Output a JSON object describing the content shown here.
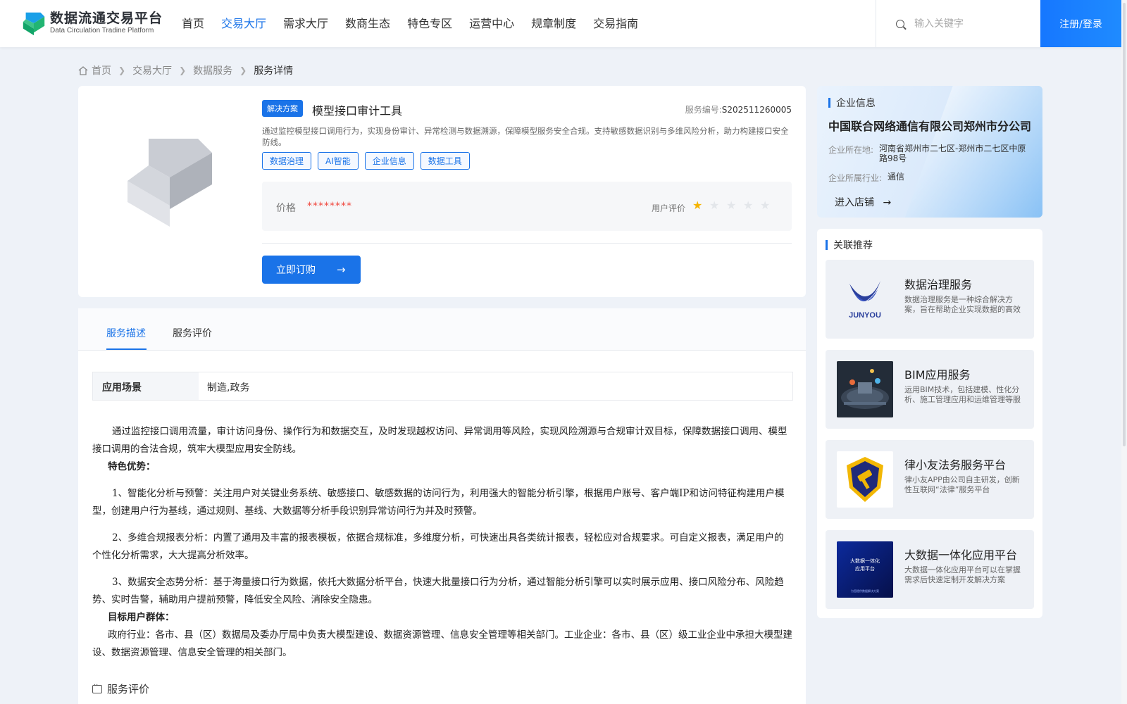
{
  "header": {
    "logo_cn": "数据流通交易平台",
    "logo_en": "Data Circulation Tradine Platform",
    "nav": [
      "首页",
      "交易大厅",
      "需求大厅",
      "数商生态",
      "特色专区",
      "运营中心",
      "规章制度",
      "交易指南"
    ],
    "nav_active_index": 1,
    "search_placeholder": "输入关键字",
    "login_label": "注册/登录"
  },
  "breadcrumb": {
    "items": [
      "首页",
      "交易大厅",
      "数据服务",
      "服务详情"
    ]
  },
  "product": {
    "badge": "解决方案",
    "title": "模型接口审计工具",
    "code_label": "服务编号:",
    "code": "S202511260005",
    "description": "通过监控模型接口调用行为，实现身份审计、异常检测与数据溯源，保障模型服务安全合规。支持敏感数据识别与多维风险分析，助力构建接口安全防线。",
    "tags": [
      "数据治理",
      "AI智能",
      "企业信息",
      "数据工具"
    ],
    "price_label": "价格",
    "price_value": "********",
    "rating_label": "用户评价",
    "rating": 1,
    "rating_max": 5,
    "buy_label": "立即订购"
  },
  "tabs": [
    "服务描述",
    "服务评价"
  ],
  "scene": {
    "key": "应用场景",
    "value": "制造,政务"
  },
  "content": {
    "intro": "通过监控接口调用流量，审计访问身份、操作行为和数据交互，及时发现越权访问、异常调用等风险，实现风险溯源与合规审计双目标，保障数据接口调用、模型接口调用的合法合规，筑牢大模型应用安全防线。",
    "advantages_head": "特色优势：",
    "adv1": "1、智能化分析与预警：关注用户对关键业务系统、敏感接口、敏感数据的访问行为，利用强大的智能分析引擎，根据用户账号、客户端IP和访问特征构建用户模型，创建用户行为基线，通过规则、基线、大数据等分析手段识别异常访问行为并及时预警。",
    "adv2": "2、多维合规报表分析：内置了通用及丰富的报表模板，依据合规标准，多维度分析，可快速出具各类统计报表，轻松应对合规要求。可自定义报表，满足用户的个性化分析需求，大大提高分析效率。",
    "adv3": "3、数据安全态势分析：基于海量接口行为数据，依托大数据分析平台，快速大批量接口行为分析，通过智能分析引擎可以实时展示应用、接口风险分布、风险趋势、实时告警，辅助用户提前预警，降低安全风险、消除安全隐患。",
    "target_head": "目标用户群体：",
    "target": "政府行业：各市、县（区）数据局及委办厅局中负责大模型建设、数据资源管理、信息安全管理等相关部门。工业企业：各市、县（区）级工业企业中承担大模型建设、数据资源管理、信息安全管理的相关部门。"
  },
  "review_title": "服务评价",
  "company": {
    "section_title": "企业信息",
    "name": "中国联合网络通信有限公司郑州市分公司",
    "location_label": "企业所在地:",
    "location": "河南省郑州市二七区-郑州市二七区中原路98号",
    "industry_label": "企业所属行业:",
    "industry": "通信",
    "enter_label": "进入店铺"
  },
  "recommend": {
    "section_title": "关联推荐",
    "items": [
      {
        "title": "数据治理服务",
        "desc": "数据治理服务是一种综合解决方案，旨在帮助企业实现数据的高效管理",
        "thumb": "junyou-logo"
      },
      {
        "title": "BIM应用服务",
        "desc": "运用BIM技术，包括建模、性化分析、施工管理应用和运维管理等服务",
        "thumb": "bim-scene"
      },
      {
        "title": "律小友法务服务平台",
        "desc": "律小友APP由公司自主研发，创新性互联网“法律”服务平台",
        "thumb": "law-shield"
      },
      {
        "title": "大数据一体化应用平台",
        "desc": "大数据一体化应用平台可以在掌握需求后快速定制开发解决方案",
        "thumb": "bigdata-screen"
      }
    ],
    "thumb_texts": {
      "junyou": "JUNYOU",
      "bigdata_line1": "大数据一体化",
      "bigdata_line2": "应用平台",
      "bigdata_foot": "为您提供数据解决方案"
    }
  },
  "colors": {
    "accent": "#1a73e8",
    "price": "#f0473e",
    "star": "#f5b400"
  }
}
